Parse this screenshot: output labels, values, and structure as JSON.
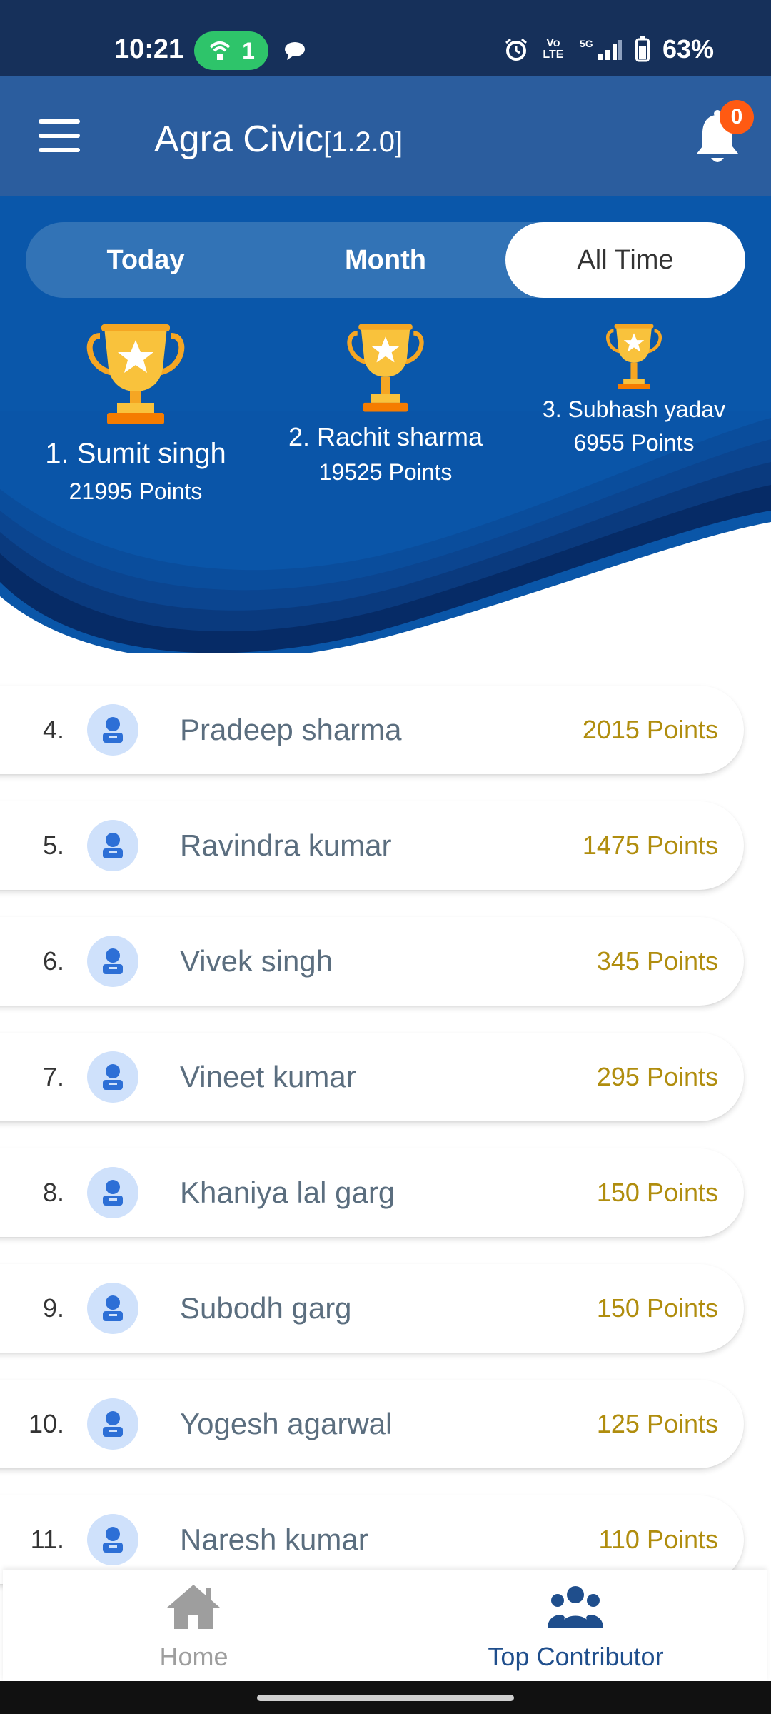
{
  "status_bar": {
    "time": "10:21",
    "hotspot_count": "1",
    "battery": "63%",
    "network": "5G",
    "volte": "Vo LTE"
  },
  "app_bar": {
    "title": "Agra Civic",
    "version": "[1.2.0]",
    "notification_count": "0",
    "bg_color": "#2b5d9e"
  },
  "tabs": [
    {
      "label": "Today",
      "active": false
    },
    {
      "label": "Month",
      "active": false
    },
    {
      "label": "All Time",
      "active": true
    }
  ],
  "podium": [
    {
      "name": "1. Sumit singh",
      "points": "21995 Points"
    },
    {
      "name": "2. Rachit sharma",
      "points": "19525 Points"
    },
    {
      "name": "3. Subhash yadav",
      "points": "6955 Points"
    }
  ],
  "list": [
    {
      "rank": "4.",
      "name": "Pradeep sharma",
      "points": "2015 Points"
    },
    {
      "rank": "5.",
      "name": "Ravindra kumar",
      "points": "1475 Points"
    },
    {
      "rank": "6.",
      "name": "Vivek singh",
      "points": "345 Points"
    },
    {
      "rank": "7.",
      "name": "Vineet kumar",
      "points": "295 Points"
    },
    {
      "rank": "8.",
      "name": "Khaniya lal garg",
      "points": "150 Points"
    },
    {
      "rank": "9.",
      "name": "Subodh garg",
      "points": "150 Points"
    },
    {
      "rank": "10.",
      "name": "Yogesh agarwal",
      "points": "125 Points"
    },
    {
      "rank": "11.",
      "name": "Naresh kumar",
      "points": "110 Points"
    }
  ],
  "bottom_nav": [
    {
      "label": "Home",
      "icon": "home-icon",
      "active": false
    },
    {
      "label": "Top Contributor",
      "icon": "group-icon",
      "active": true
    }
  ],
  "colors": {
    "accent": "#1f4e8c",
    "points": "#b08d0e",
    "hero_dark": "#0d2c63",
    "hero_light": "#0a5cb0",
    "inactive": "#9e9e9e"
  }
}
